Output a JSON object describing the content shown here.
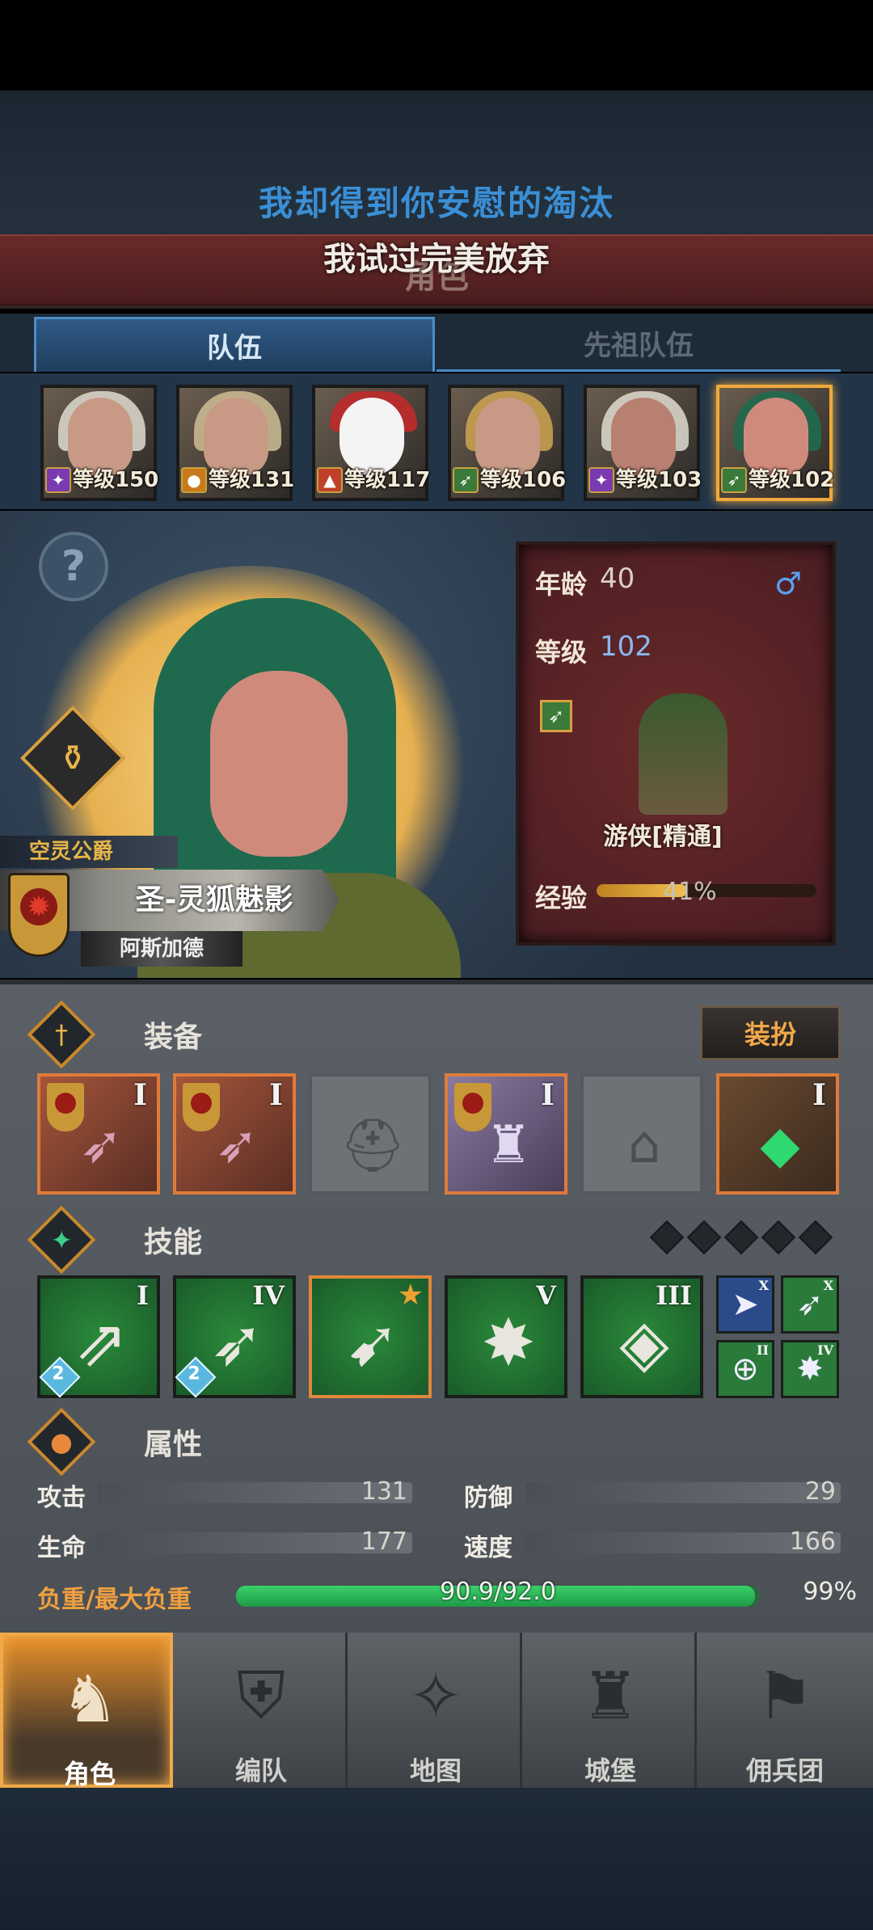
{
  "header": {
    "lyric_line1": "我却得到你安慰的淘汰",
    "page_title": "角色",
    "lyric_line2": "我试过完美放弃"
  },
  "tabs": [
    {
      "label": "队伍",
      "active": true
    },
    {
      "label": "先祖队伍",
      "active": false
    }
  ],
  "team": [
    {
      "level_text": "等级150",
      "class_icon": "staff-icon",
      "class_color": "#7a3ab0"
    },
    {
      "level_text": "等级131",
      "class_icon": "fist-icon",
      "class_color": "#c87a1a"
    },
    {
      "level_text": "等级117",
      "class_icon": "bear-icon",
      "class_color": "#c0402a"
    },
    {
      "level_text": "等级106",
      "class_icon": "bow-icon",
      "class_color": "#3c7a3a"
    },
    {
      "level_text": "等级103",
      "class_icon": "staff-icon",
      "class_color": "#7a3ab0"
    },
    {
      "level_text": "等级102",
      "class_icon": "bow-icon",
      "class_color": "#3c7a3a",
      "selected": true
    }
  ],
  "hero": {
    "rank": "空灵公爵",
    "name": "圣-灵狐魅影",
    "realm": "阿斯加德",
    "age_label": "年龄",
    "age": "40",
    "gender_symbol": "♂",
    "level_label": "等级",
    "level": "102",
    "class_name": "游侠[精通]",
    "exp_label": "经验",
    "exp_percent": "41%",
    "exp_fraction": 0.41
  },
  "equipment": {
    "title": "装备",
    "dress_button": "装扮",
    "slots": [
      {
        "item": "bow",
        "tier": "I",
        "filled": true
      },
      {
        "item": "bow",
        "tier": "I",
        "filled": true
      },
      {
        "item": "helmet-placeholder",
        "tier": "",
        "filled": false
      },
      {
        "item": "armor",
        "tier": "I",
        "filled": true
      },
      {
        "item": "boots-placeholder",
        "tier": "",
        "filled": false
      },
      {
        "item": "emerald-quiver",
        "tier": "I",
        "filled": true
      }
    ]
  },
  "skills": {
    "title": "技能",
    "main": [
      {
        "tier": "I",
        "count": "2"
      },
      {
        "tier": "IV",
        "count": "2"
      },
      {
        "tier": "",
        "starred": true
      },
      {
        "tier": "V"
      },
      {
        "tier": "III"
      }
    ],
    "passive": [
      {
        "tier": "X"
      },
      {
        "tier": "X"
      },
      {
        "tier": "II"
      },
      {
        "tier": "IV"
      }
    ]
  },
  "attributes": {
    "title": "属性",
    "attack_label": "攻击",
    "attack": "131",
    "defense_label": "防御",
    "defense": "29",
    "hp_label": "生命",
    "hp": "177",
    "speed_label": "速度",
    "speed": "166",
    "load_label": "负重/最大负重",
    "load_value": "90.9/92.0",
    "load_percent": "99%",
    "load_fraction": 0.99
  },
  "nav": [
    {
      "label": "角色",
      "active": true
    },
    {
      "label": "编队"
    },
    {
      "label": "地图"
    },
    {
      "label": "城堡"
    },
    {
      "label": "佣兵团"
    }
  ]
}
